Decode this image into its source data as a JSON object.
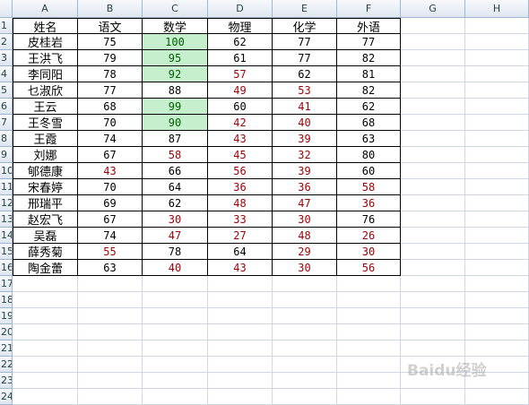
{
  "columns": [
    "A",
    "B",
    "C",
    "D",
    "E",
    "F",
    "G",
    "H"
  ],
  "row_numbers": [
    "1",
    "2",
    "3",
    "4",
    "5",
    "6",
    "7",
    "8",
    "9",
    "10",
    "11",
    "12",
    "13",
    "14",
    "15",
    "16",
    "17",
    "18",
    "19",
    "20",
    "21",
    "22",
    "23",
    "24"
  ],
  "headers": [
    "姓名",
    "语文",
    "数学",
    "物理",
    "化学",
    "外语"
  ],
  "rows": [
    {
      "name": "皮桂岩",
      "scores": [
        "75",
        "100",
        "62",
        "77",
        "77"
      ]
    },
    {
      "name": "王洪飞",
      "scores": [
        "79",
        "95",
        "61",
        "77",
        "82"
      ]
    },
    {
      "name": "李同阳",
      "scores": [
        "78",
        "92",
        "57",
        "62",
        "81"
      ]
    },
    {
      "name": "乜淑欣",
      "scores": [
        "77",
        "88",
        "49",
        "53",
        "82"
      ]
    },
    {
      "name": "王云",
      "scores": [
        "68",
        "99",
        "60",
        "41",
        "62"
      ]
    },
    {
      "name": "王冬雪",
      "scores": [
        "70",
        "90",
        "42",
        "40",
        "68"
      ]
    },
    {
      "name": "王霞",
      "scores": [
        "74",
        "87",
        "43",
        "39",
        "63"
      ]
    },
    {
      "name": "刘娜",
      "scores": [
        "67",
        "58",
        "45",
        "32",
        "80"
      ]
    },
    {
      "name": "郇德康",
      "scores": [
        "43",
        "66",
        "56",
        "39",
        "60"
      ]
    },
    {
      "name": "宋春婷",
      "scores": [
        "70",
        "64",
        "36",
        "36",
        "58"
      ]
    },
    {
      "name": "邢瑞平",
      "scores": [
        "69",
        "62",
        "48",
        "47",
        "36"
      ]
    },
    {
      "name": "赵宏飞",
      "scores": [
        "67",
        "30",
        "33",
        "30",
        "76"
      ]
    },
    {
      "name": "吴磊",
      "scores": [
        "74",
        "47",
        "27",
        "48",
        "26"
      ]
    },
    {
      "name": "薛秀菊",
      "scores": [
        "55",
        "78",
        "64",
        "29",
        "30"
      ]
    },
    {
      "name": "陶金蕾",
      "scores": [
        "63",
        "40",
        "43",
        "30",
        "56"
      ]
    }
  ],
  "colors": {
    "normal_text": "#000000",
    "fail_text": "#9c0006",
    "high_text": "#006100",
    "high_fill": "#c6efce"
  },
  "watermark": "Baidu经验"
}
